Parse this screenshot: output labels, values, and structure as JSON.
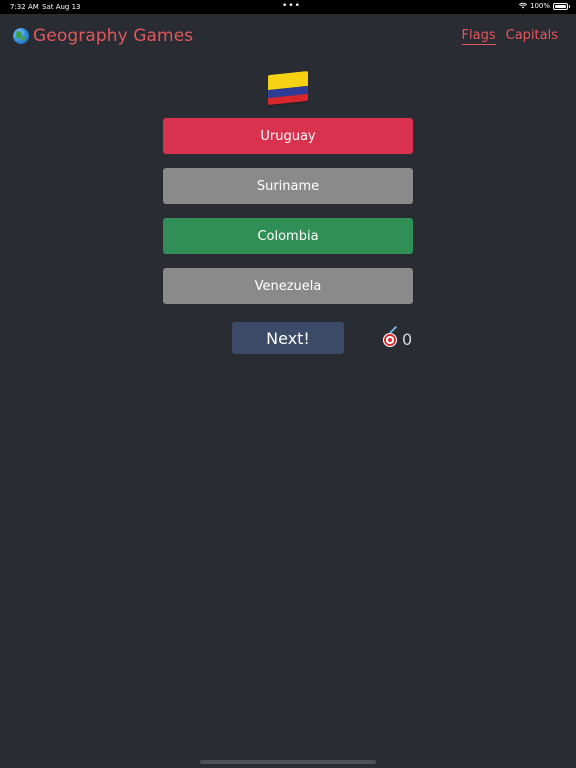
{
  "status_bar": {
    "time": "7:32 AM",
    "date": "Sat Aug 13",
    "dots": "•••",
    "battery": "100%"
  },
  "header": {
    "title": "Geography Games",
    "icon": "globe-icon",
    "nav": [
      {
        "label": "Flags",
        "active": true
      },
      {
        "label": "Capitals",
        "active": false
      }
    ]
  },
  "quiz": {
    "flag": "colombia-flag",
    "answers": [
      {
        "label": "Uruguay",
        "state": "wrong"
      },
      {
        "label": "Suriname",
        "state": "neutral"
      },
      {
        "label": "Colombia",
        "state": "correct"
      },
      {
        "label": "Venezuela",
        "state": "neutral"
      }
    ],
    "next_label": "Next!",
    "score": "0",
    "score_icon": "dart-target-icon"
  },
  "colors": {
    "background": "#2a2c33",
    "accent": "#e0585c",
    "wrong": "#d9324e",
    "correct": "#2f8f55",
    "neutral": "#8a8a8a",
    "next_button": "#3b4a66"
  }
}
